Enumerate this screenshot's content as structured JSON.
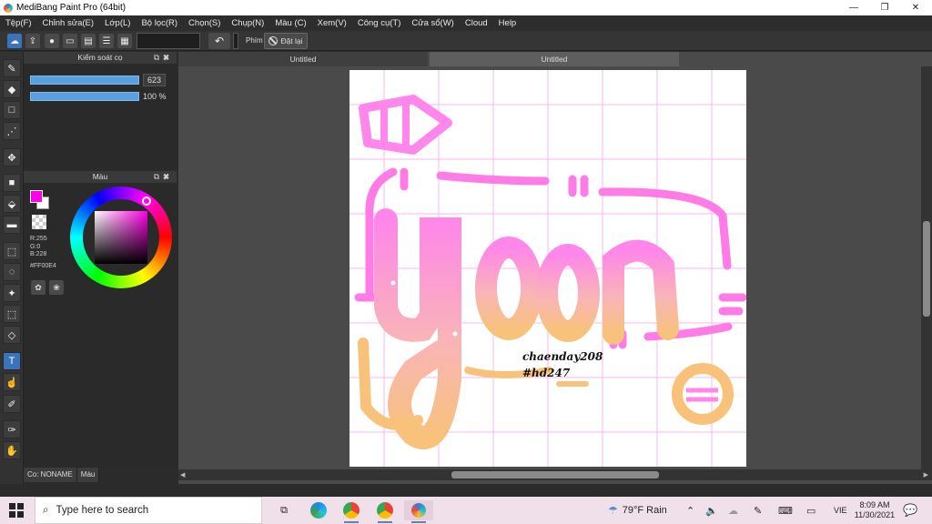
{
  "window": {
    "title": "MediBang Paint Pro (64bit)"
  },
  "menu": [
    "Tệp(F)",
    "Chỉnh sửa(E)",
    "Lớp(L)",
    "Bộ lọc(R)",
    "Chọn(S)",
    "Chụp(N)",
    "Màu (C)",
    "Xem(V)",
    "Công cụ(T)",
    "Cửa sổ(W)",
    "Cloud",
    "Help"
  ],
  "toolbar": {
    "shortcut_label": "Phím",
    "reset_label": "Đặt lại"
  },
  "brush_panel": {
    "title": "Kiểm soát cọ",
    "size_value": "623",
    "opacity_value": "100 %"
  },
  "color_panel": {
    "title": "Màu",
    "fg_color": "#FF00E4",
    "r": "R:255",
    "g": "G:0",
    "b": "B:228",
    "hex": "#FF00E4"
  },
  "panel_tabs": [
    "Co: NONAME",
    "Màu"
  ],
  "document": {
    "tabs": [
      "Untitled",
      "Untitled"
    ],
    "watermark_line1": "chaenday208",
    "watermark_line2": "#hd247"
  },
  "taskbar": {
    "search_placeholder": "Type here to search",
    "weather": "79°F  Rain",
    "language": "VIE",
    "time": "8:09 AM",
    "date": "11/30/2021"
  },
  "colors": {
    "accent": "#3a73b8",
    "pink": "#ff7be6",
    "orange": "#f8c27a"
  }
}
